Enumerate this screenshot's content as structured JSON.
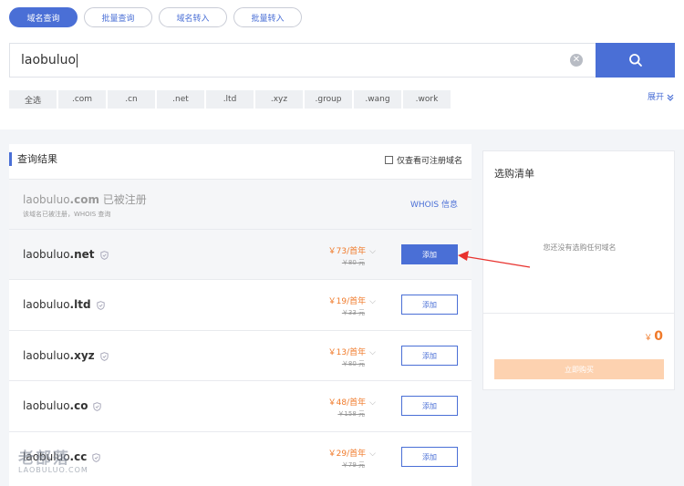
{
  "tabs": [
    {
      "label": "域名查询"
    },
    {
      "label": "批量查询"
    },
    {
      "label": "域名转入"
    },
    {
      "label": "批量转入"
    }
  ],
  "search": {
    "value": "laobuluo"
  },
  "tlds": [
    "全选",
    ".com",
    ".cn",
    ".net",
    ".ltd",
    ".xyz",
    ".group",
    ".wang",
    ".work"
  ],
  "expand_label": "展开",
  "results": {
    "title": "查询结果",
    "only_available": "仅查看可注册域名",
    "registered": {
      "prefix": "laobuluo",
      "suffix": ".com",
      "status": "已被注册",
      "note": "该域名已被注册，WHOIS 查询",
      "whois": "WHOIS 信息"
    },
    "rows": [
      {
        "prefix": "laobuluo",
        "suffix": ".net",
        "price": "￥73/首年",
        "old_price": "￥80 元",
        "add": "添加"
      },
      {
        "prefix": "laobuluo",
        "suffix": ".ltd",
        "price": "￥19/首年",
        "old_price": "￥33 元",
        "add": "添加"
      },
      {
        "prefix": "laobuluo",
        "suffix": ".xyz",
        "price": "￥13/首年",
        "old_price": "￥80 元",
        "add": "添加"
      },
      {
        "prefix": "laobuluo",
        "suffix": ".co",
        "price": "￥48/首年",
        "old_price": "￥158 元",
        "add": "添加"
      },
      {
        "prefix": "laobuluo",
        "suffix": ".cc",
        "price": "￥29/首年",
        "old_price": "￥79 元",
        "add": "添加"
      }
    ]
  },
  "cart": {
    "title": "选购清单",
    "empty": "您还没有选购任何域名",
    "currency": "￥",
    "total": "0",
    "buy": "立即购买"
  },
  "watermark": {
    "big": "老部落",
    "small": "LAOBULUO.COM"
  },
  "colors": {
    "accent": "#4a6fd6",
    "price": "#f07a2a",
    "arrow": "#e8322e"
  }
}
